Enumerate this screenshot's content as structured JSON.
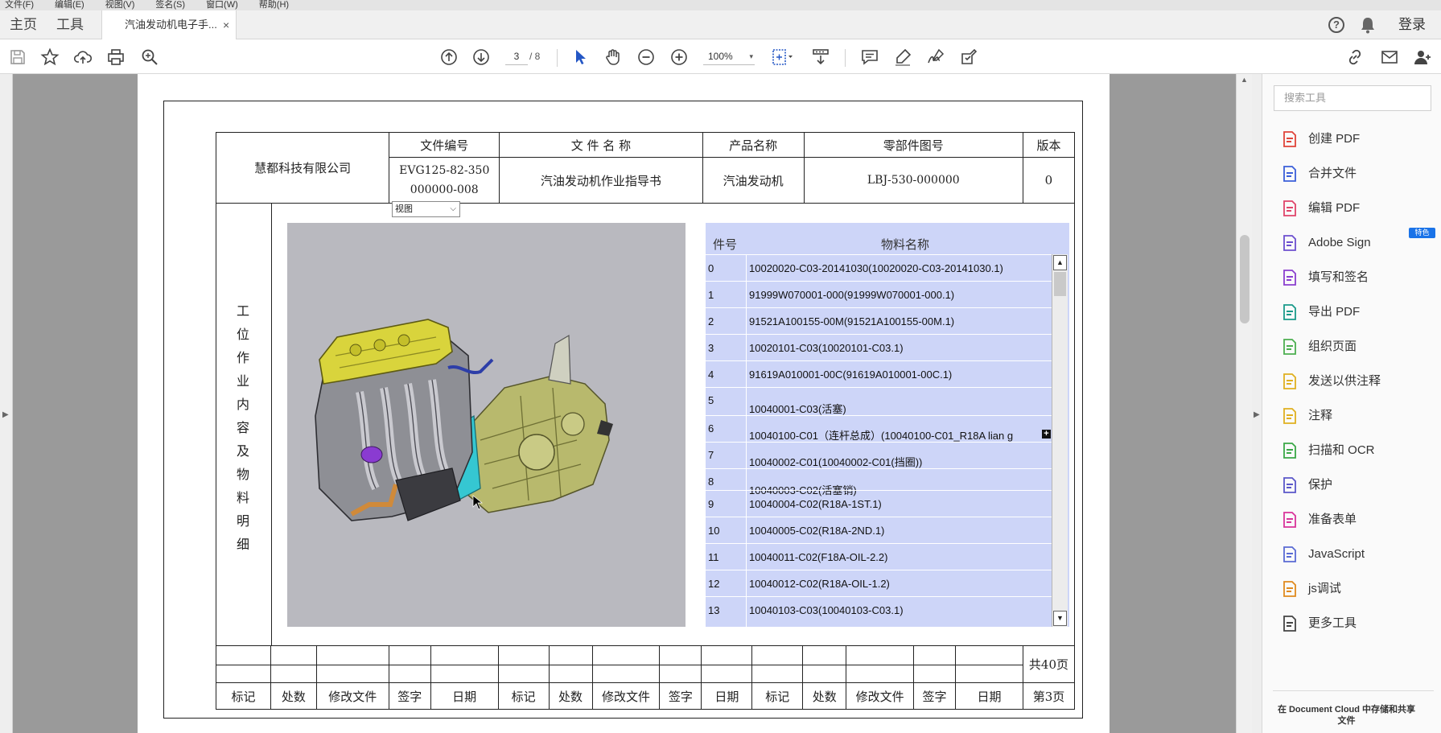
{
  "menu": [
    "文件(F)",
    "编辑(E)",
    "视图(V)",
    "签名(S)",
    "窗口(W)",
    "帮助(H)"
  ],
  "tabs": {
    "home": "主页",
    "tools": "工具",
    "document": "汽油发动机电子手...",
    "close": "×"
  },
  "header_right": {
    "login": "登录"
  },
  "toolbar": {
    "page_current": "3",
    "page_total": "/ 8",
    "zoom": "100%",
    "zoom_caret": "▾"
  },
  "icons": {
    "save": "save-icon",
    "bookmark": "star-icon",
    "upload": "cloud-upload-icon",
    "print": "print-icon",
    "search": "magnifier-icon",
    "prev_page": "arrow-up-circle-icon",
    "next_page": "arrow-down-circle-icon",
    "select": "pointer-icon",
    "hand": "hand-icon",
    "zoom_out": "zoom-out-icon",
    "zoom_in": "zoom-in-icon",
    "fit": "fit-page-icon",
    "scroll_mode": "scroll-mode-icon",
    "comment": "comment-icon",
    "highlight": "highlight-icon",
    "sign": "sign-icon",
    "stamp": "stamp-icon",
    "link": "link-icon",
    "mail": "mail-icon",
    "share": "share-user-icon"
  },
  "document": {
    "company": "慧都科技有限公司",
    "headers": {
      "file_no": "文件编号",
      "file_name": "文 件 名 称",
      "product": "产品名称",
      "part_no": "零部件图号",
      "version": "版本"
    },
    "values": {
      "file_no_1": "EVG125-82-350",
      "file_no_2": "000000-008",
      "file_name": "汽油发动机作业指导书",
      "product": "汽油发动机",
      "part_no": "LBJ-530-000000",
      "version": "0"
    },
    "side_label": "工位作业内容及物料明细",
    "view_select": "视图",
    "parts_header": {
      "num": "件号",
      "name": "物料名称"
    },
    "parts": [
      {
        "num": "0",
        "name": "10020020-C03-20141030(10020020-C03-20141030.1)"
      },
      {
        "num": "1",
        "name": "91999W070001-000(91999W070001-000.1)"
      },
      {
        "num": "2",
        "name": "91521A100155-00M(91521A100155-00M.1)"
      },
      {
        "num": "3",
        "name": "10020101-C03(10020101-C03.1)"
      },
      {
        "num": "4",
        "name": "91619A010001-00C(91619A010001-00C.1)"
      },
      {
        "num": "5",
        "name": "10040001-C03(活塞)"
      },
      {
        "num": "6",
        "name": "10040100-C01（连杆总成）(10040100-C01_R18A lian g"
      },
      {
        "num": "7",
        "name": "10040002-C01(10040002-C01(挡圈))"
      },
      {
        "num": "8",
        "name": "10040003-C02(活塞销)"
      },
      {
        "num": "9",
        "name": "10040004-C02(R18A-1ST.1)"
      },
      {
        "num": "10",
        "name": "10040005-C02(R18A-2ND.1)"
      },
      {
        "num": "11",
        "name": "10040011-C02(F18A-OIL-2.2)"
      },
      {
        "num": "12",
        "name": "10040012-C02(R18A-OIL-1.2)"
      },
      {
        "num": "13",
        "name": "10040103-C03(10040103-C03.1)"
      }
    ],
    "footer_labels": [
      "标记",
      "处数",
      "修改文件",
      "签字",
      "日期",
      "标记",
      "处数",
      "修改文件",
      "签字",
      "日期",
      "标记",
      "处数",
      "修改文件",
      "签字",
      "日期"
    ],
    "total_pages": "共40页",
    "current_page": "第3页"
  },
  "tools_panel": {
    "search_placeholder": "搜索工具",
    "items": [
      {
        "label": "创建 PDF",
        "icon": "create-pdf-icon",
        "color": "#e0443a"
      },
      {
        "label": "合并文件",
        "icon": "combine-files-icon",
        "color": "#3b5fd9"
      },
      {
        "label": "编辑 PDF",
        "icon": "edit-pdf-icon",
        "color": "#e0446a"
      },
      {
        "label": "Adobe Sign",
        "icon": "adobe-sign-icon",
        "color": "#6c4fcf"
      },
      {
        "label": "填写和签名",
        "icon": "fill-sign-icon",
        "color": "#8a3fcf"
      },
      {
        "label": "导出 PDF",
        "icon": "export-pdf-icon",
        "color": "#1a9a8a"
      },
      {
        "label": "组织页面",
        "icon": "organize-pages-icon",
        "color": "#4caf50"
      },
      {
        "label": "发送以供注释",
        "icon": "send-comments-icon",
        "color": "#e0b020"
      },
      {
        "label": "注释",
        "icon": "comment-tool-icon",
        "color": "#e0b020"
      },
      {
        "label": "扫描和 OCR",
        "icon": "scan-ocr-icon",
        "color": "#3aa847"
      },
      {
        "label": "保护",
        "icon": "protect-icon",
        "color": "#5b57c9"
      },
      {
        "label": "准备表单",
        "icon": "prepare-form-icon",
        "color": "#d9349b"
      },
      {
        "label": "JavaScript",
        "icon": "javascript-icon",
        "color": "#5a6bd4"
      },
      {
        "label": "js调试",
        "icon": "js-debug-icon",
        "color": "#e08a1e"
      },
      {
        "label": "更多工具",
        "icon": "more-tools-icon",
        "color": "#444444"
      }
    ],
    "badge": "特色",
    "footer": "在 Document Cloud 中存储和共享文件"
  }
}
